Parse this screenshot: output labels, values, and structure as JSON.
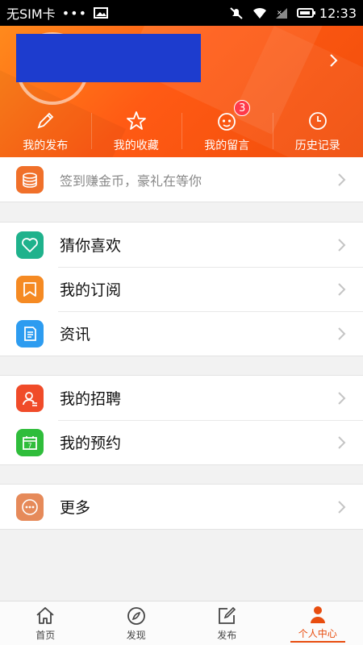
{
  "status_bar": {
    "carrier": "无SIM卡",
    "dots": "•••",
    "time": "12:33"
  },
  "header": {
    "quick_actions": [
      {
        "label": "我的发布",
        "icon": "pencil-icon"
      },
      {
        "label": "我的收藏",
        "icon": "star-icon"
      },
      {
        "label": "我的留言",
        "icon": "message-face-icon",
        "badge": "3"
      },
      {
        "label": "历史记录",
        "icon": "clock-icon"
      }
    ]
  },
  "signin": {
    "label": "签到赚金币，豪礼在等你",
    "icon": "coins-icon",
    "color": "#f0702a"
  },
  "section1": [
    {
      "label": "猜你喜欢",
      "icon": "heart-icon",
      "color": "#1fb28c"
    },
    {
      "label": "我的订阅",
      "icon": "bookmark-icon",
      "color": "#f58a23"
    },
    {
      "label": "资讯",
      "icon": "news-icon",
      "color": "#2d9cf0"
    }
  ],
  "section2": [
    {
      "label": "我的招聘",
      "icon": "recruit-icon",
      "color": "#f04b29"
    },
    {
      "label": "我的预约",
      "icon": "calendar-icon",
      "color": "#2fbd3b"
    }
  ],
  "section3": [
    {
      "label": "更多",
      "icon": "more-icon",
      "color": "#e68a5a"
    }
  ],
  "bottom_nav": [
    {
      "label": "首页",
      "icon": "home-icon"
    },
    {
      "label": "发现",
      "icon": "compass-icon"
    },
    {
      "label": "发布",
      "icon": "edit-icon"
    },
    {
      "label": "个人中心",
      "icon": "person-icon",
      "active": true
    }
  ],
  "colors": {
    "brand": "#ff5a14",
    "active": "#e84d0f"
  }
}
